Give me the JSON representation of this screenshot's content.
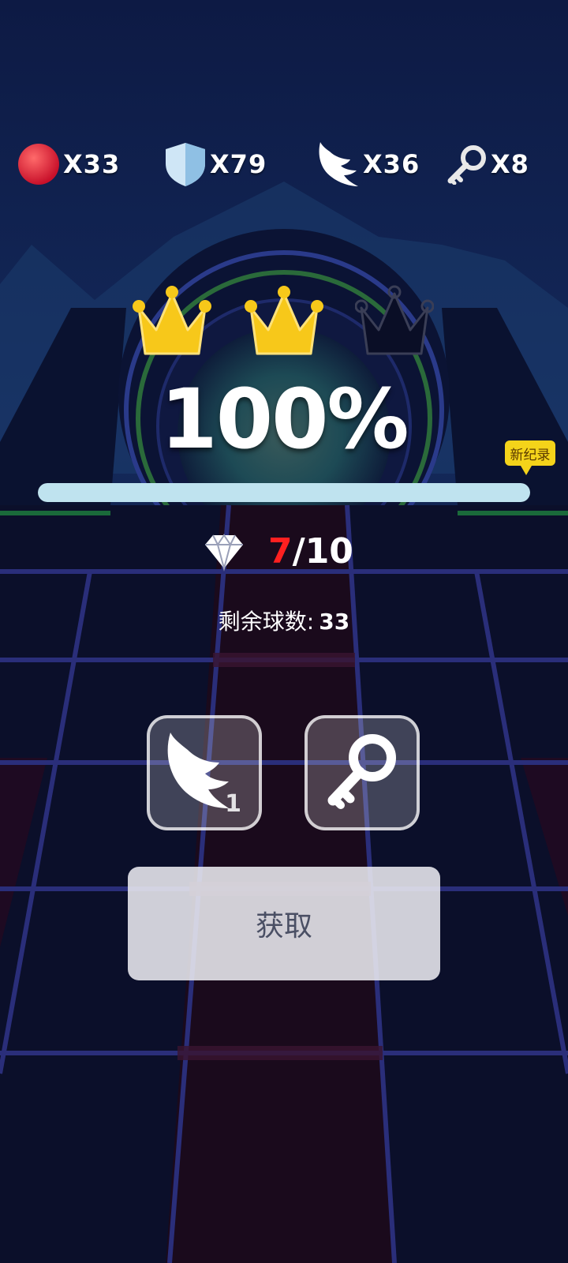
{
  "counters": {
    "ball": {
      "label": "X33",
      "icon": "red-ball-icon"
    },
    "shield": {
      "label": "X79",
      "icon": "shield-icon"
    },
    "wing": {
      "label": "X36",
      "icon": "wing-icon"
    },
    "key": {
      "label": "X8",
      "icon": "key-icon"
    }
  },
  "crowns": {
    "earned": 2,
    "total": 3,
    "icon": "crown-icon"
  },
  "progress": {
    "percent_text": "100%",
    "value_percent": 100,
    "badge": "新纪录"
  },
  "gems": {
    "current": "7",
    "separator_total": "/10",
    "icon": "diamond-icon"
  },
  "balls_left": {
    "label": "剩余球数:",
    "value": "33"
  },
  "powerups": [
    {
      "name": "wing",
      "icon": "wing-icon",
      "count": "1"
    },
    {
      "name": "key",
      "icon": "key-icon"
    }
  ],
  "get_button": {
    "label": "获取"
  },
  "colors": {
    "crown_gold": "#f7c81a",
    "gem_current": "#ff2020",
    "badge": "#f4d31a"
  }
}
